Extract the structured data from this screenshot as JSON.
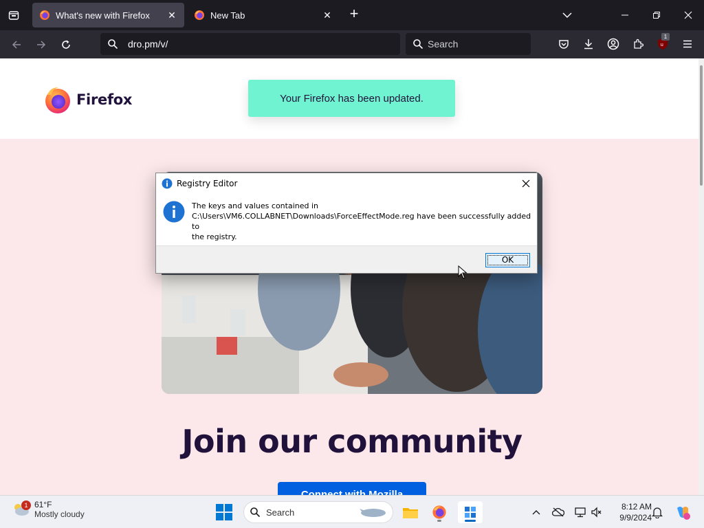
{
  "browser": {
    "tabs": [
      {
        "title": "What's new with Firefox",
        "active": true
      },
      {
        "title": "New Tab",
        "active": false
      }
    ],
    "url": "dro.pm/v/",
    "search_placeholder": "Search",
    "extension_badge": "1"
  },
  "page": {
    "logo_text": "Firefox",
    "toast": "Your Firefox has been updated.",
    "heading": "Join our community",
    "cta": "Connect with Mozilla"
  },
  "dialog": {
    "title": "Registry Editor",
    "message_line1": "The keys and values contained in",
    "message_line2": "C:\\Users\\VM6.COLLABNET\\Downloads\\ForceEffectMode.reg have been successfully added to",
    "message_line3": "the registry.",
    "ok_label": "OK"
  },
  "taskbar": {
    "weather_temp": "61°F",
    "weather_cond": "Mostly cloudy",
    "weather_badge": "1",
    "search_placeholder": "Search",
    "time": "8:12 AM",
    "date": "9/9/2024"
  },
  "colors": {
    "toast_bg": "#6ff3d0",
    "page_bg": "#fce8ea",
    "cta_bg": "#0060df",
    "heading": "#20123a"
  }
}
